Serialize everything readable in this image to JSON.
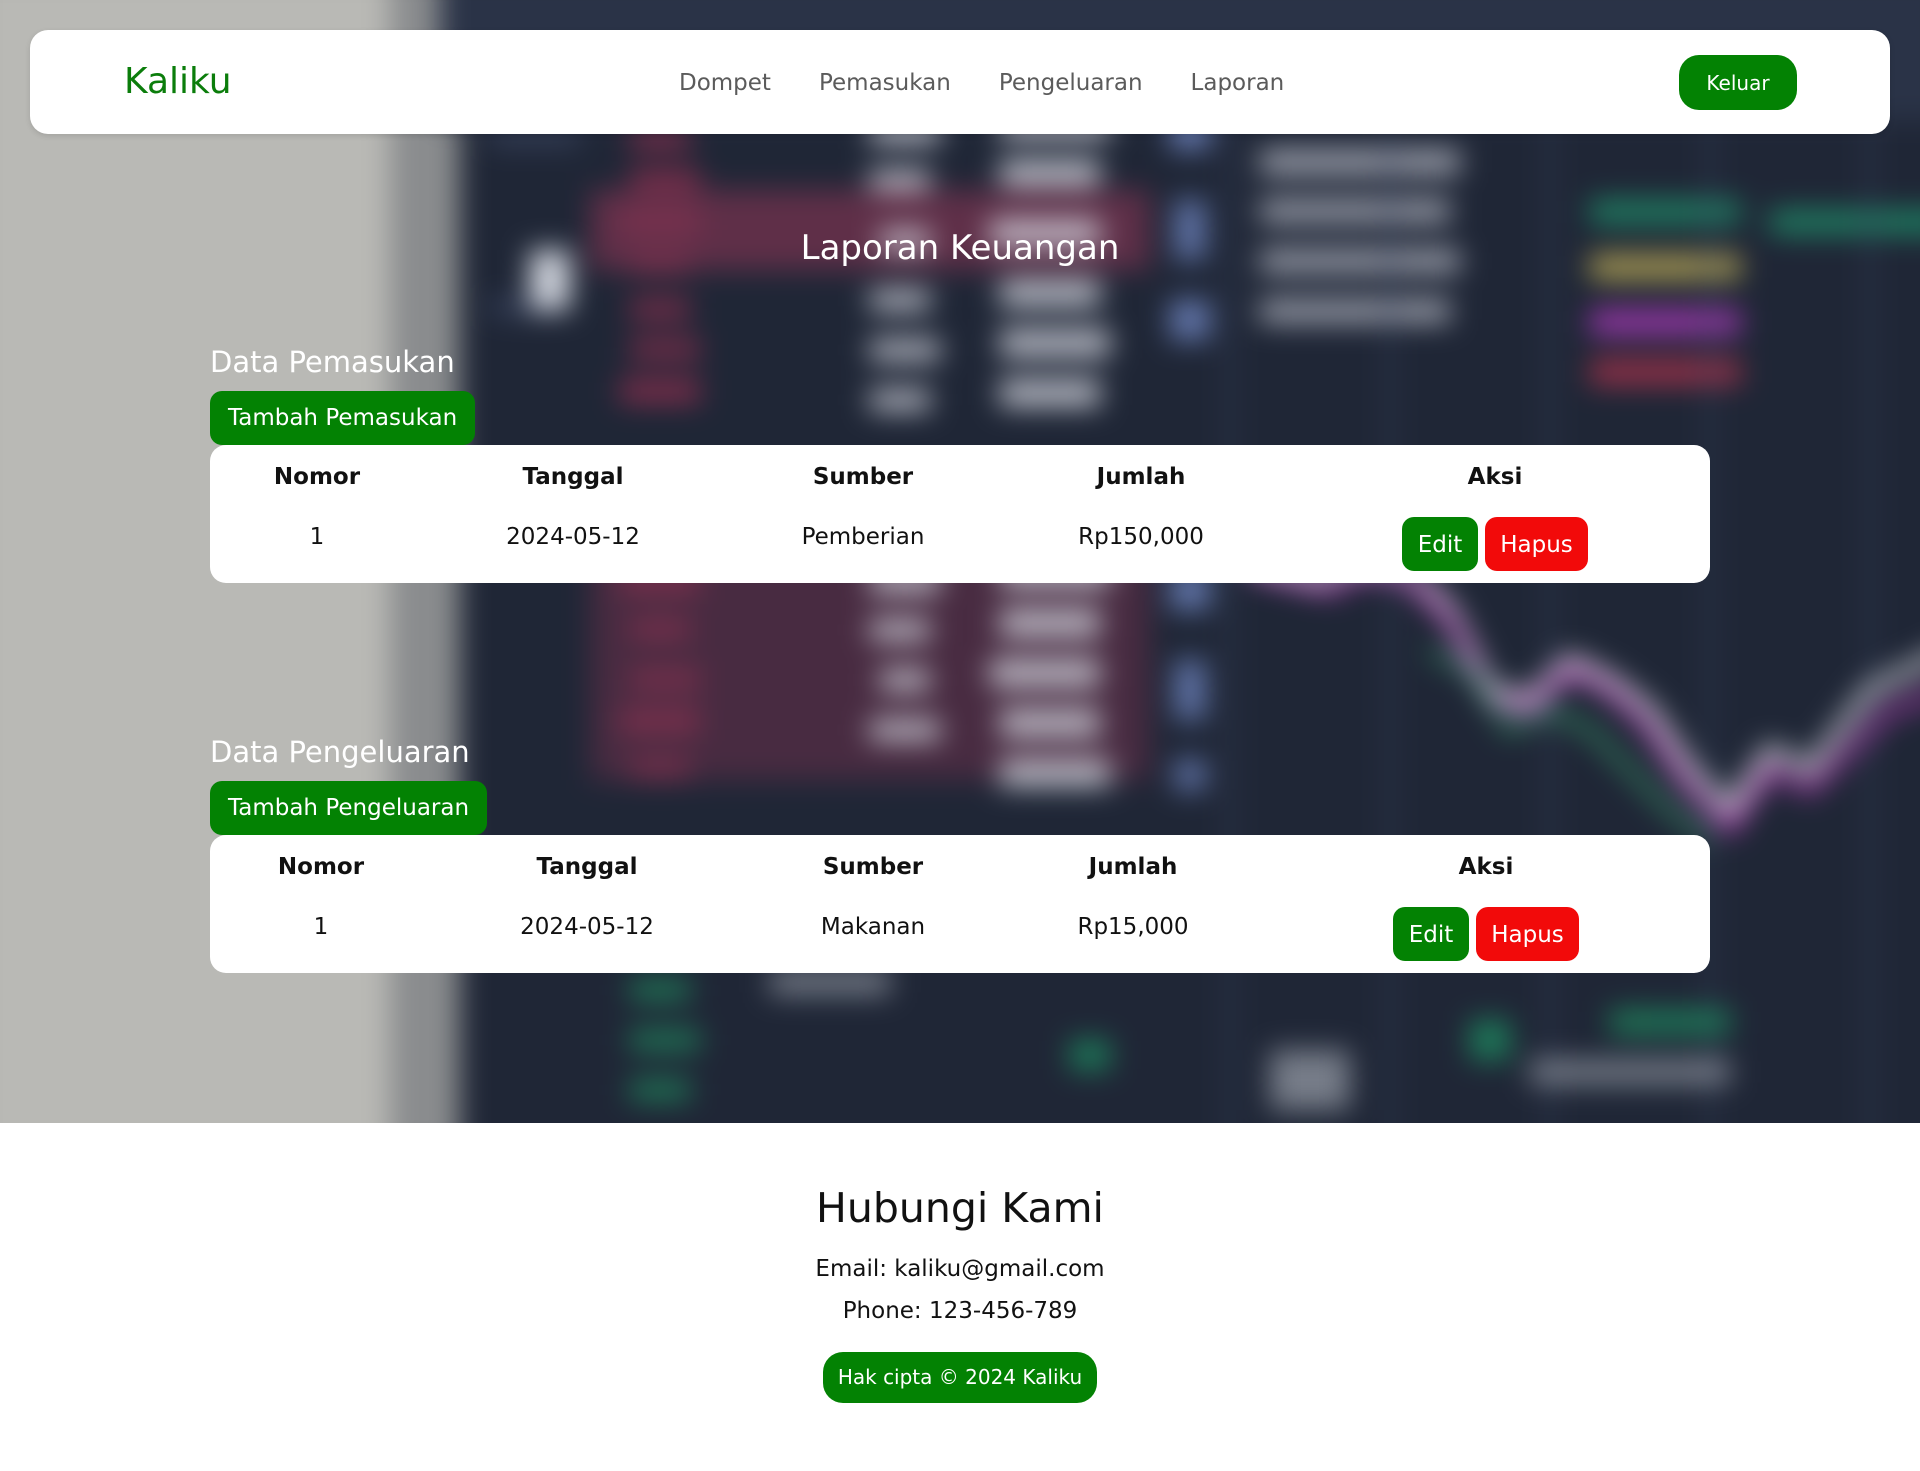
{
  "navbar": {
    "brand": "Kaliku",
    "links": [
      "Dompet",
      "Pemasukan",
      "Pengeluaran",
      "Laporan"
    ],
    "logout_label": "Keluar"
  },
  "page": {
    "title": "Laporan Keuangan"
  },
  "income": {
    "title": "Data Pemasukan",
    "add_label": "Tambah Pemasukan",
    "headers": [
      "Nomor",
      "Tanggal",
      "Sumber",
      "Jumlah",
      "Aksi"
    ],
    "rows": [
      {
        "nomor": "1",
        "tanggal": "2024-05-12",
        "sumber": "Pemberian",
        "jumlah": "Rp150,000"
      }
    ],
    "edit_label": "Edit",
    "delete_label": "Hapus"
  },
  "expense": {
    "title": "Data Pengeluaran",
    "add_label": "Tambah Pengeluaran",
    "headers": [
      "Nomor",
      "Tanggal",
      "Sumber",
      "Jumlah",
      "Aksi"
    ],
    "rows": [
      {
        "nomor": "1",
        "tanggal": "2024-05-12",
        "sumber": "Makanan",
        "jumlah": "Rp15,000"
      }
    ],
    "edit_label": "Edit",
    "delete_label": "Hapus"
  },
  "footer": {
    "title": "Hubungi Kami",
    "email": "Email: kaliku@gmail.com",
    "phone": "Phone: 123-456-789",
    "copyright": "Hak cipta © 2024 Kaliku"
  },
  "colors": {
    "brand": "#0b7d0b",
    "primary_button": "#038203",
    "danger_button": "#f20a0a"
  }
}
